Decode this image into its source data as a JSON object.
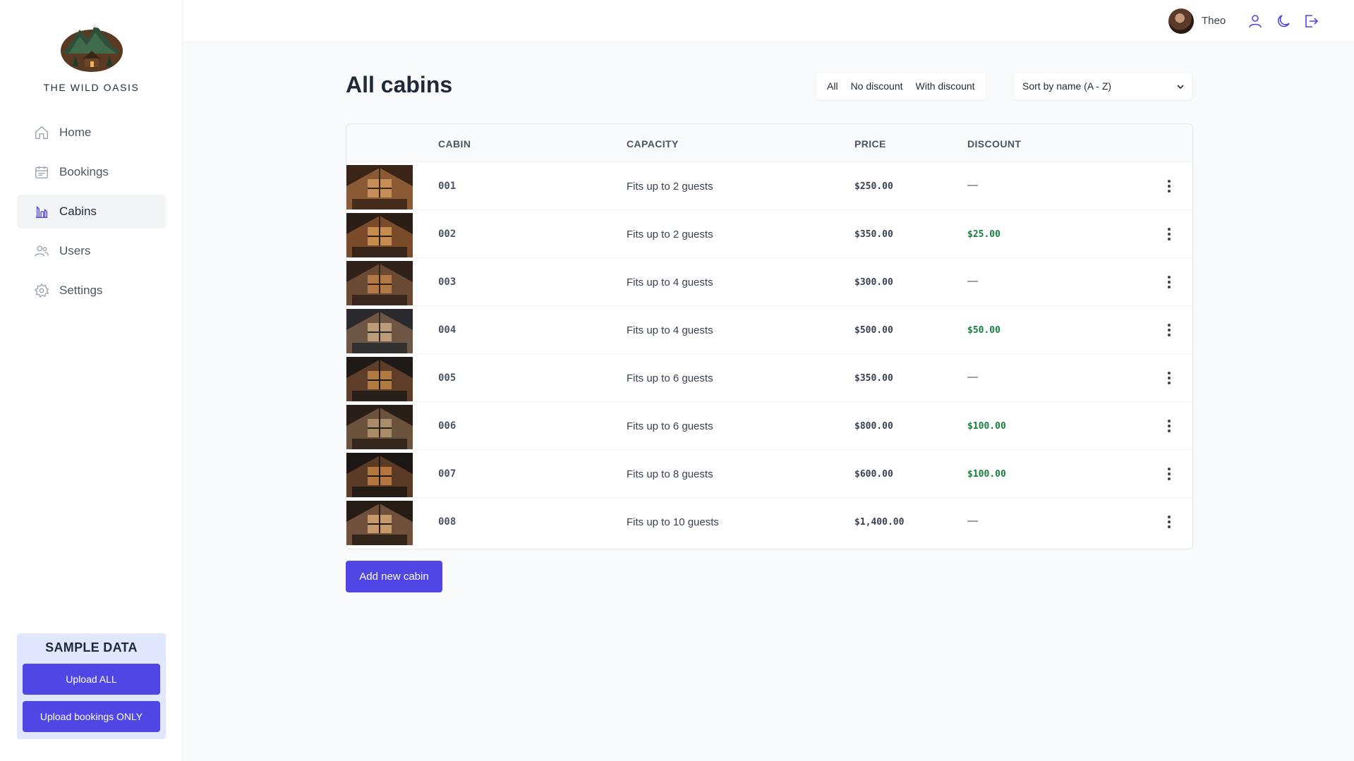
{
  "app": {
    "logo_text": "THE WILD OASIS"
  },
  "sidebar": {
    "items": [
      {
        "label": "Home",
        "icon": "home-icon"
      },
      {
        "label": "Bookings",
        "icon": "calendar-icon"
      },
      {
        "label": "Cabins",
        "icon": "cabins-icon",
        "active": true
      },
      {
        "label": "Users",
        "icon": "users-icon"
      },
      {
        "label": "Settings",
        "icon": "gear-icon"
      }
    ],
    "sample": {
      "title": "SAMPLE DATA",
      "upload_all": "Upload ALL",
      "upload_bookings": "Upload bookings ONLY"
    }
  },
  "header": {
    "username": "Theo",
    "icons": [
      "user-icon",
      "moon-icon",
      "logout-icon"
    ]
  },
  "main": {
    "title": "All cabins",
    "filters": [
      "All",
      "No discount",
      "With discount"
    ],
    "sort_selected": "Sort by name (A - Z)",
    "columns": [
      "CABIN",
      "CAPACITY",
      "PRICE",
      "DISCOUNT"
    ],
    "rows": [
      {
        "name": "001",
        "capacity": "Fits up to 2 guests",
        "price": "$250.00",
        "discount": "—"
      },
      {
        "name": "002",
        "capacity": "Fits up to 2 guests",
        "price": "$350.00",
        "discount": "$25.00"
      },
      {
        "name": "003",
        "capacity": "Fits up to 4 guests",
        "price": "$300.00",
        "discount": "—"
      },
      {
        "name": "004",
        "capacity": "Fits up to 4 guests",
        "price": "$500.00",
        "discount": "$50.00"
      },
      {
        "name": "005",
        "capacity": "Fits up to 6 guests",
        "price": "$350.00",
        "discount": "—"
      },
      {
        "name": "006",
        "capacity": "Fits up to 6 guests",
        "price": "$800.00",
        "discount": "$100.00"
      },
      {
        "name": "007",
        "capacity": "Fits up to 8 guests",
        "price": "$600.00",
        "discount": "$100.00"
      },
      {
        "name": "008",
        "capacity": "Fits up to 10 guests",
        "price": "$1,400.00",
        "discount": "—"
      }
    ],
    "add_button": "Add new cabin"
  },
  "colors": {
    "brand": "#4f46e5",
    "discount_green": "#15803d",
    "sample_bg": "#e0e7ff"
  }
}
